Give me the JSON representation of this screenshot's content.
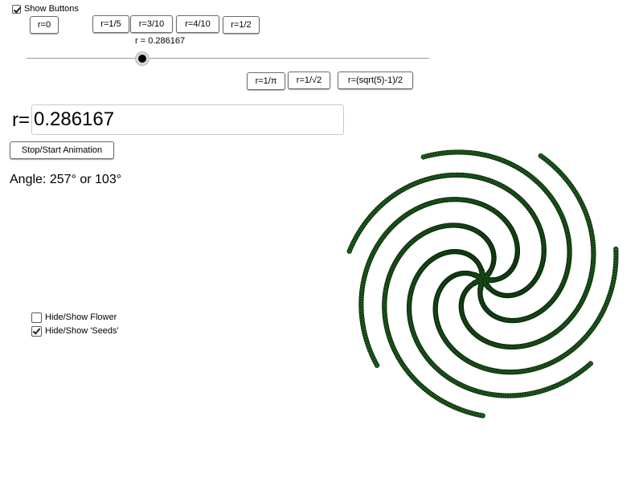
{
  "controls": {
    "show_buttons": {
      "label": "Show Buttons",
      "checked": true
    },
    "preset_buttons_row1": [
      "r=0",
      "r=1/5",
      "r=3/10",
      "r=4/10",
      "r=1/2"
    ],
    "preset_buttons_row2": [
      "r=1/π",
      "r=1/√2",
      "r=(sqrt(5)-1)/2"
    ],
    "slider": {
      "label": "r = 0.286167",
      "value": 0.286167,
      "min": 0,
      "max": 1
    },
    "r_input": {
      "prefix": "r=",
      "value": "0.286167"
    },
    "animation_button": "Stop/Start Animation",
    "angle_text": "Angle: 257° or 103°",
    "hide_flower": {
      "label": "Hide/Show Flower",
      "checked": false
    },
    "hide_seeds": {
      "label": "Hide/Show 'Seeds'",
      "checked": true
    }
  },
  "flower": {
    "seed_color": "#1e5e1e",
    "seed_outline": "#0a250a",
    "r": 0.286167,
    "seed_count": 1400
  }
}
